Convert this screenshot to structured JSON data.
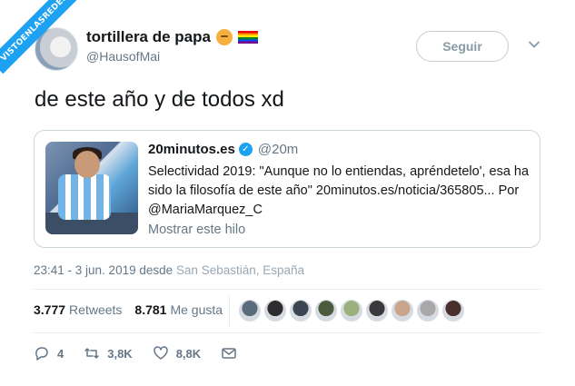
{
  "watermark": "VISTOENLASREDES",
  "user": {
    "display_name": "tortillera de papa",
    "handle": "@HausofMai",
    "emojis": [
      "thinking-face",
      "rainbow-flag"
    ]
  },
  "follow_label": "Seguir",
  "tweet_text": "de este año y de todos xd",
  "quote": {
    "name": "20minutos.es",
    "handle": "@20m",
    "body": "Selectividad 2019: \"Aunque no lo entiendas, apréndetelo', esa ha sido la filosofía de este año\" 20minutos.es/noticia/365805... Por @MariaMarquez_C",
    "thread_link": "Mostrar este hilo"
  },
  "meta": {
    "time_date": "23:41 - 3 jun. 2019",
    "from": "desde",
    "place": "San Sebastián, España"
  },
  "stats": {
    "retweets_count": "3.777",
    "retweets_label": "Retweets",
    "likes_count": "8.781",
    "likes_label": "Me gusta"
  },
  "likers": [
    {
      "color": "#5a6b7c"
    },
    {
      "color": "#2d2d2d"
    },
    {
      "color": "#3b4552"
    },
    {
      "color": "#4c5b3d"
    },
    {
      "color": "#9bb07a"
    },
    {
      "color": "#3a3a3a"
    },
    {
      "color": "#c9a58b"
    },
    {
      "color": "#a8a8a8"
    },
    {
      "color": "#4a2f2f"
    }
  ],
  "actions": {
    "replies": "4",
    "retweets": "3,8K",
    "likes": "8,8K"
  },
  "colors": {
    "accent": "#1da1f2",
    "secondary_text": "#657786"
  }
}
